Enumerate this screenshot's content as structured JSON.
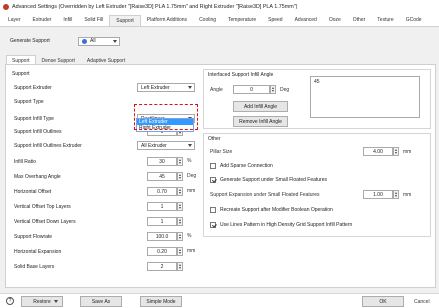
{
  "window": {
    "title": "Advanced Settings (Overridden by Left Extruder \"[Raise3D] PLA 1.75mm\" and Right Extruder \"[Raise3D] PLA 1.75mm\")"
  },
  "tabs": [
    "Layer",
    "Extruder",
    "Infill",
    "Solid Fill",
    "Support",
    "Platform Additions",
    "Cooling",
    "Temperature",
    "Speed",
    "Advanced",
    "Ooze",
    "Other",
    "Texture",
    "GCode"
  ],
  "general_support": {
    "label": "Generate Support",
    "value": "All"
  },
  "subtabs": [
    "Support",
    "Dense Support",
    "Adaptive Support"
  ],
  "support": {
    "section_title": "Support",
    "extruder": {
      "label": "Support Extruder",
      "value": "Left Extruder",
      "options": [
        "Left Extruder",
        "Right Extruder"
      ]
    },
    "type_label": "Support Type",
    "infill_type": {
      "label": "Support Infill Type",
      "value": "Rectilinear"
    },
    "infill_outlines": {
      "label": "Support Infill Outlines",
      "value": "0"
    },
    "outlines_extruder": {
      "label": "Support Infill Outlines Extruder",
      "value": "All Extruder"
    },
    "infill_ratio": {
      "label": "Infill Ratio",
      "value": "30",
      "unit": "%"
    },
    "overhang": {
      "label": "Max Overhang Angle",
      "value": "45",
      "unit": "Deg"
    },
    "h_offset": {
      "label": "Horizontal Offset",
      "value": "0.70",
      "unit": "mm"
    },
    "v_top": {
      "label": "Vertical Offset Top Layers",
      "value": "1"
    },
    "v_down": {
      "label": "Vertical Offset Down Layers",
      "value": "1"
    },
    "flowrate": {
      "label": "Support Flowrate",
      "value": "100.0",
      "unit": "%"
    },
    "h_expansion": {
      "label": "Horizontal Expansion",
      "value": "0.20",
      "unit": "mm"
    },
    "solid_base": {
      "label": "Solid Base Layers",
      "value": "2"
    }
  },
  "infill_angle": {
    "section_title": "Interfaced Support Infill Angle",
    "angle_label": "Angle",
    "angle_value": "0",
    "angle_unit": "Deg",
    "list_value": "45",
    "add_btn": "Add Infill Angle",
    "remove_btn": "Remove Infill Angle"
  },
  "other": {
    "section_title": "Other",
    "pillar": {
      "label": "Pillar Size",
      "value": "4.00",
      "unit": "mm"
    },
    "sparse": {
      "label": "Add Sparse Connection",
      "checked": false
    },
    "small_features": {
      "label": "Generate Support under Small Floated Features",
      "checked": true
    },
    "expansion": {
      "label": "Support Expansion under Small Floated Features",
      "value": "1.00",
      "unit": "mm"
    },
    "recreate": {
      "label": "Recreate Support after Modifier Boolean Operation",
      "checked": false
    },
    "lines_pattern": {
      "label": "Use Lines Pattern in High Density Grid Support Infill Pattern",
      "checked": true
    }
  },
  "bottom": {
    "help": "?",
    "restore": "Restore",
    "save_as": "Save As",
    "simple": "Simple Mode",
    "ok": "OK",
    "cancel": "Cancel"
  }
}
